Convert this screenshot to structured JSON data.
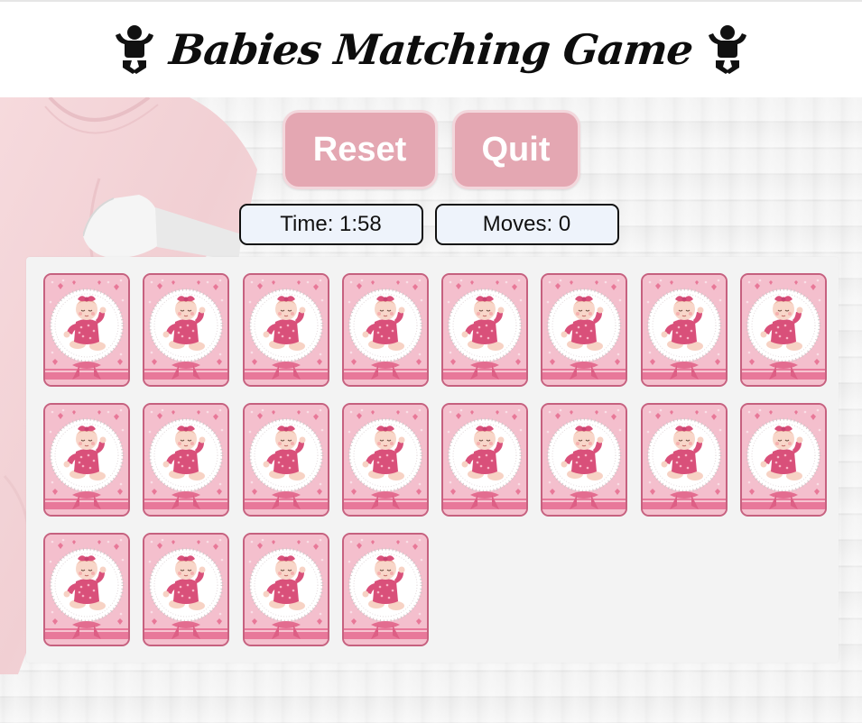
{
  "header": {
    "title": "Babies Matching Game",
    "left_icon": "baby-icon",
    "right_icon": "baby-icon"
  },
  "controls": {
    "reset_label": "Reset",
    "quit_label": "Quit"
  },
  "stats": {
    "time_label": "Time:",
    "time_value": "1:58",
    "moves_label": "Moves:",
    "moves_value": "0"
  },
  "board": {
    "card_count": 20,
    "card_back": "baby-card-back-icon"
  },
  "colors": {
    "button": "#e4a7b2",
    "button_text": "#ffffff",
    "stat_bg": "#eef3fb",
    "card_border": "#c6617f",
    "card_pink": "#f4bfcd",
    "board_bg": "#f3f3f3"
  }
}
